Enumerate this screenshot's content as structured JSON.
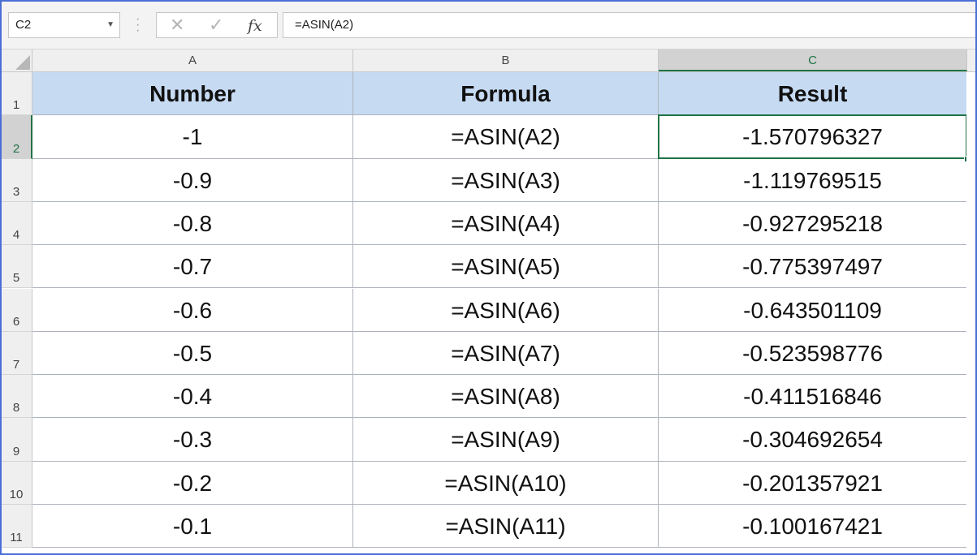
{
  "name_box": {
    "value": "C2"
  },
  "formula_bar": {
    "cancel_glyph": "✕",
    "enter_glyph": "✓",
    "fx_label": "fx",
    "formula": "=ASIN(A2)"
  },
  "columns": [
    "A",
    "B",
    "C"
  ],
  "rows": [
    "1",
    "2",
    "3",
    "4",
    "5",
    "6",
    "7",
    "8",
    "9",
    "10",
    "11"
  ],
  "selected_cell": "C2",
  "table": {
    "headers": [
      "Number",
      "Formula",
      "Result"
    ],
    "data": [
      [
        "-1",
        "=ASIN(A2)",
        "-1.570796327"
      ],
      [
        "-0.9",
        "=ASIN(A3)",
        "-1.119769515"
      ],
      [
        "-0.8",
        "=ASIN(A4)",
        "-0.927295218"
      ],
      [
        "-0.7",
        "=ASIN(A5)",
        "-0.775397497"
      ],
      [
        "-0.6",
        "=ASIN(A6)",
        "-0.643501109"
      ],
      [
        "-0.5",
        "=ASIN(A7)",
        "-0.523598776"
      ],
      [
        "-0.4",
        "=ASIN(A8)",
        "-0.411516846"
      ],
      [
        "-0.3",
        "=ASIN(A9)",
        "-0.304692654"
      ],
      [
        "-0.2",
        "=ASIN(A10)",
        "-0.201357921"
      ],
      [
        "-0.1",
        "=ASIN(A11)",
        "-0.100167421"
      ]
    ]
  },
  "colors": {
    "header_fill": "#c6daf2",
    "selection": "#217346",
    "frame": "#4a6fd6"
  }
}
